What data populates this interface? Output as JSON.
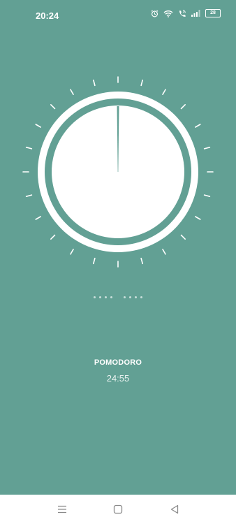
{
  "status_bar": {
    "time": "20:24",
    "battery": "28",
    "icons": [
      "alarm-icon",
      "wifi-icon",
      "call-icon",
      "signal-icon",
      "battery-icon"
    ]
  },
  "timer": {
    "name": "POMODORO",
    "remaining": "24:55"
  },
  "page_indicator": {
    "groups": 2,
    "dots_per_group": 4
  },
  "nav_bar": {
    "buttons": [
      "menu-icon",
      "home-icon",
      "back-icon"
    ]
  },
  "colors": {
    "background": "#62a094",
    "dial": "#ffffff",
    "nav_bar": "#ffffff"
  }
}
